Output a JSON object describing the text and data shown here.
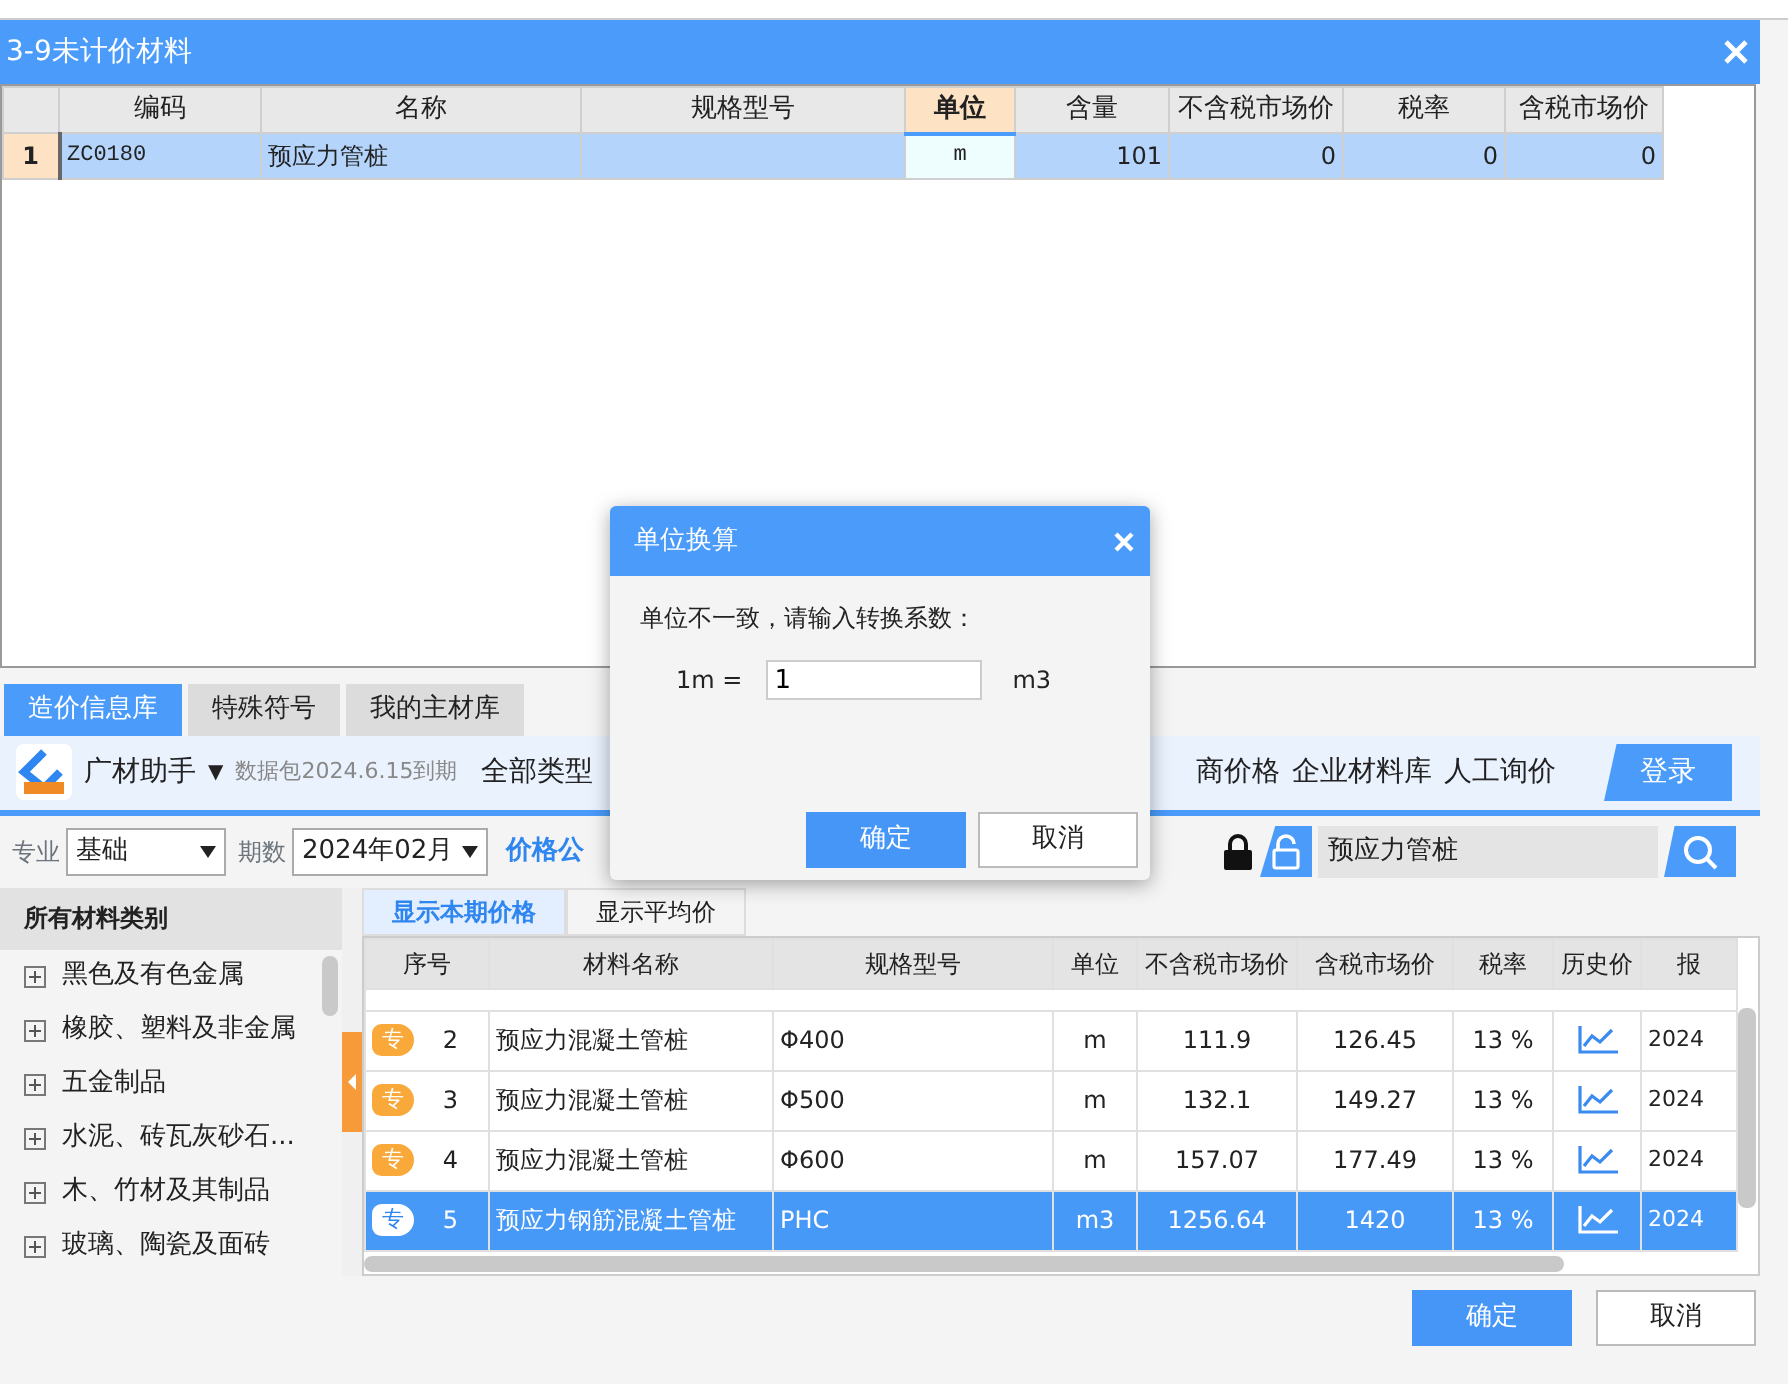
{
  "window": {
    "title": "3-9未计价材料"
  },
  "grid": {
    "columns": [
      {
        "label": "编码",
        "kind": "code",
        "active": false
      },
      {
        "label": "名称",
        "kind": "text",
        "active": false
      },
      {
        "label": "规格型号",
        "kind": "text",
        "active": false
      },
      {
        "label": "单位",
        "kind": "code",
        "active": true
      },
      {
        "label": "含量",
        "kind": "number",
        "active": false
      },
      {
        "label": "不含税市场价",
        "kind": "number",
        "active": false
      },
      {
        "label": "税率",
        "kind": "number",
        "active": false
      },
      {
        "label": "含税市场价",
        "kind": "number",
        "active": false
      }
    ],
    "rows": [
      {
        "row_number": "1",
        "selected": true,
        "cells": [
          "ZC0180",
          "预应力管桩",
          null,
          "m",
          "101",
          "0",
          "0",
          "0"
        ]
      }
    ]
  },
  "library_tabs": [
    {
      "label": "造价信息库",
      "selected": true
    },
    {
      "label": "特殊符号",
      "selected": false
    },
    {
      "label": "我的主材库",
      "selected": false
    }
  ],
  "toolbar": {
    "app_name": "广材助手",
    "dropdown": "▼",
    "package_note": "数据包2024.6.15到期",
    "left_links": [
      "全部类型"
    ],
    "right_links": [
      "商价格",
      "企业材料库",
      "人工询价"
    ],
    "login": "登录"
  },
  "filters": {
    "specialty_label": "专业",
    "specialty": "基础",
    "period_label": "期数",
    "period": "2024年02月",
    "price_link": "价格公",
    "search_value": "预应力管桩"
  },
  "categories": {
    "title": "所有材料类别",
    "items": [
      "黑色及有色金属",
      "橡胶、塑料及非金属",
      "五金制品",
      "水泥、砖瓦灰砂石...",
      "木、竹材及其制品",
      "玻璃、陶瓷及面砖"
    ]
  },
  "price_tabs": [
    {
      "label": "显示本期价格",
      "selected": true
    },
    {
      "label": "显示平均价",
      "selected": false
    }
  ],
  "materials": {
    "columns": [
      "序号",
      "材料名称",
      "规格型号",
      "单位",
      "不含税市场价",
      "含税市场价",
      "税率",
      "历史价",
      "报"
    ],
    "rows": [
      {
        "badge": "专",
        "index": "2",
        "name": "预应力混凝土管桩",
        "spec": "Φ400",
        "unit": "m",
        "price_ex_tax": "111.9",
        "price_inc_tax": "126.45",
        "tax_rate": "13 %",
        "quote": "2024",
        "selected": false
      },
      {
        "badge": "专",
        "index": "3",
        "name": "预应力混凝土管桩",
        "spec": "Φ500",
        "unit": "m",
        "price_ex_tax": "132.1",
        "price_inc_tax": "149.27",
        "tax_rate": "13 %",
        "quote": "2024",
        "selected": false
      },
      {
        "badge": "专",
        "index": "4",
        "name": "预应力混凝土管桩",
        "spec": "Φ600",
        "unit": "m",
        "price_ex_tax": "157.07",
        "price_inc_tax": "177.49",
        "tax_rate": "13 %",
        "quote": "2024",
        "selected": false
      },
      {
        "badge": "专",
        "index": "5",
        "name": "预应力钢筋混凝土管桩",
        "spec": "PHC",
        "unit": "m3",
        "price_ex_tax": "1256.64",
        "price_inc_tax": "1420",
        "tax_rate": "13 %",
        "quote": "2024",
        "selected": true
      }
    ]
  },
  "buttons": [
    {
      "label": "确定",
      "kind": "primary"
    },
    {
      "label": "取消",
      "kind": "secondary"
    }
  ],
  "modal": {
    "title": "单位换算",
    "message": "单位不一致，请输入转换系数：",
    "from_label": "1m =",
    "factor": "1",
    "to_unit": "m3",
    "buttons": [
      {
        "label": "确定",
        "kind": "primary"
      },
      {
        "label": "取消",
        "kind": "secondary"
      }
    ]
  }
}
